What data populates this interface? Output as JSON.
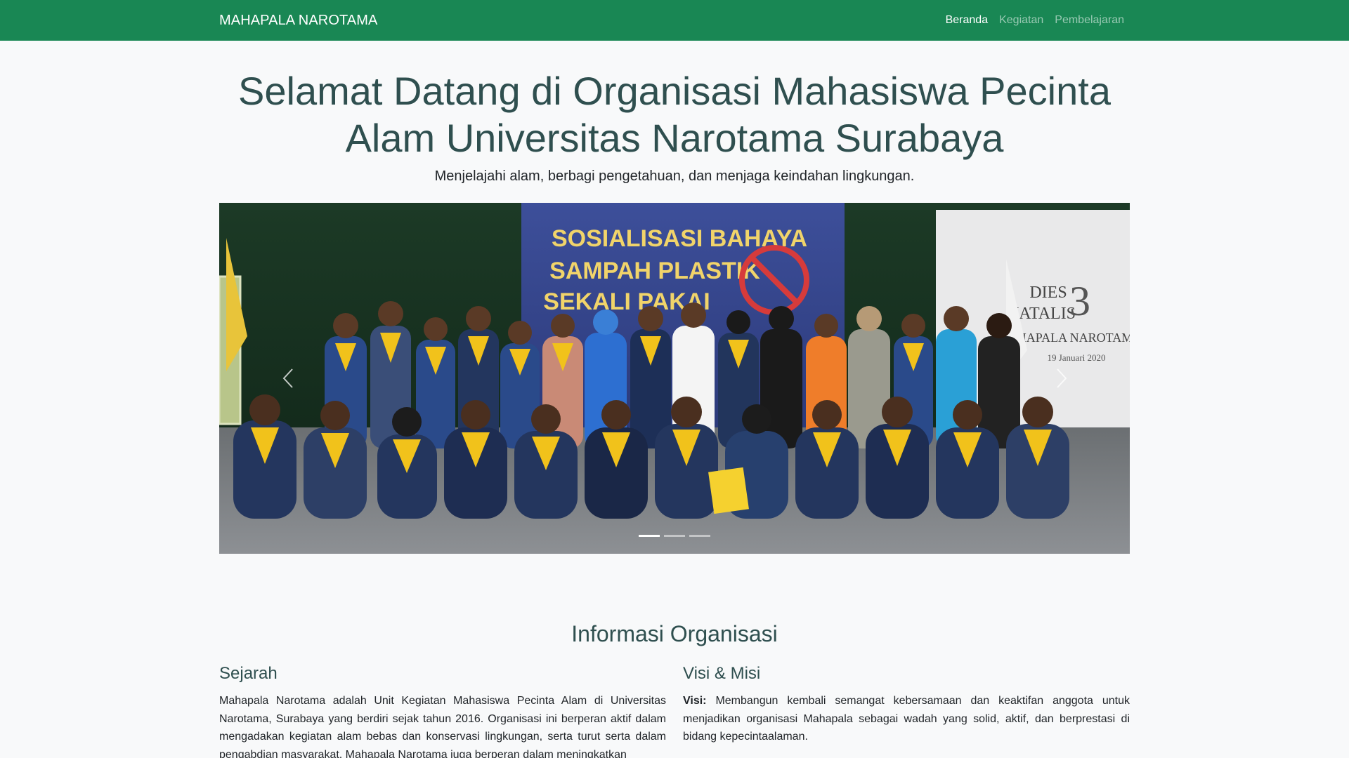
{
  "navbar": {
    "brand": "MAHAPALA NAROTAMA",
    "links": [
      {
        "label": "Beranda",
        "active": true
      },
      {
        "label": "Kegiatan",
        "active": false
      },
      {
        "label": "Pembelajaran",
        "active": false
      }
    ],
    "bg_color": "#198754"
  },
  "hero": {
    "title": "Selamat Datang di Organisasi Mahasiswa Pecinta Alam Universitas Narotama Surabaya",
    "subtitle": "Menjelajahi alam, berbagi pengetahuan, dan menjaga keindahan lingkungan."
  },
  "carousel": {
    "banner_text": [
      "SOSIALISASI BAHAYA",
      "SAMPAH PLASTIK",
      "SEKALI PAKAI"
    ],
    "side_banner": [
      "DIES",
      "NATALIS",
      "3",
      "MAHAPALA NAROTAMA",
      "19 Januari 2020"
    ],
    "indicators": 3,
    "active_index": 0,
    "prev_icon": "chevron-left-icon",
    "next_icon": "chevron-right-icon"
  },
  "info": {
    "title": "Informasi Organisasi",
    "sejarah": {
      "heading": "Sejarah",
      "text": "Mahapala Narotama adalah Unit Kegiatan Mahasiswa Pecinta Alam di Universitas Narotama, Surabaya yang berdiri sejak tahun 2016. Organisasi ini berperan aktif dalam mengadakan kegiatan alam bebas dan konservasi lingkungan, serta turut serta dalam pengabdian masyarakat. Mahapala Narotama juga berperan dalam meningkatkan"
    },
    "visi_misi": {
      "heading": "Visi & Misi",
      "visi_label": "Visi:",
      "visi_text": " Membangun kembali semangat kebersamaan dan keaktifan anggota untuk menjadikan organisasi Mahapala sebagai wadah yang solid, aktif, dan berprestasi di bidang kepecintaalaman."
    }
  }
}
